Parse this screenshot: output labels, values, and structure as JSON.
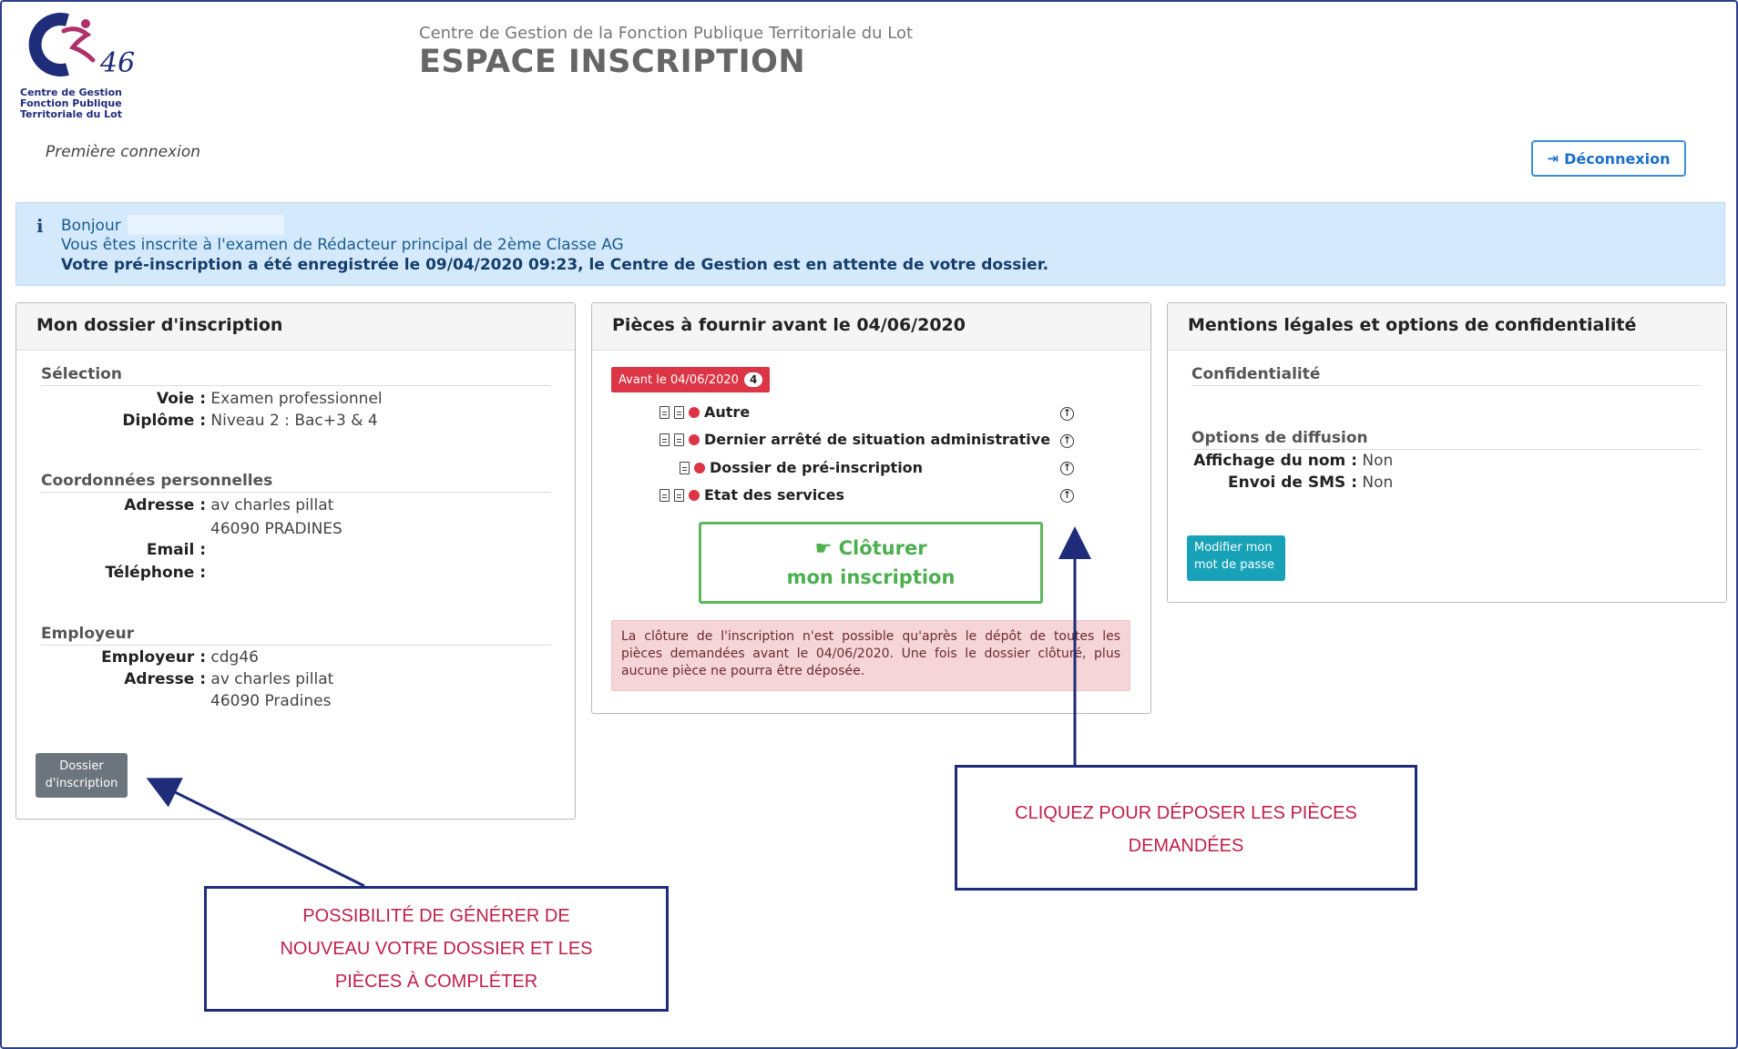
{
  "header": {
    "logo_number": "46",
    "logo_lines": [
      "Centre de Gestion",
      "Fonction Publique",
      "Territoriale du Lot"
    ],
    "organization": "Centre de Gestion de la Fonction Publique Territoriale du Lot",
    "title": "ESPACE INSCRIPTION",
    "subtitle": "Première connexion",
    "logout_label": "Déconnexion"
  },
  "banner": {
    "greeting": "Bonjour",
    "line2": "Vous êtes inscrite à l'examen de Rédacteur principal de 2ème Classe AG",
    "line3": "Votre pré-inscription a été enregistrée le 09/04/2020 09:23, le Centre de Gestion est en attente de votre dossier."
  },
  "dossier": {
    "title": "Mon dossier d'inscription",
    "selection_title": "Sélection",
    "voie_label": "Voie :",
    "voie_value": "Examen professionnel",
    "diplome_label": "Diplôme :",
    "diplome_value": "Niveau 2 : Bac+3 & 4",
    "coord_title": "Coordonnées personnelles",
    "adresse_label": "Adresse :",
    "adresse_line1": "av charles pillat",
    "adresse_line2": "46090 PRADINES",
    "email_label": "Email :",
    "tel_label": "Téléphone :",
    "employeur_title": "Employeur",
    "employeur_label": "Employeur :",
    "employeur_value": "cdg46",
    "emp_adresse_label": "Adresse :",
    "emp_adresse_line1": "av charles pillat",
    "emp_adresse_line2": "46090 Pradines",
    "button_line1": "Dossier",
    "button_line2": "d'inscription"
  },
  "pieces": {
    "title": "Pièces à fournir avant le 04/06/2020",
    "badge_label": "Avant le 04/06/2020",
    "badge_count": "4",
    "items": [
      "Autre",
      "Dernier arrêté de situation administrative",
      "Dossier de pré-inscription",
      "Etat des services"
    ],
    "close_line1": "Clôturer",
    "close_line2": "mon inscription",
    "alert": "La clôture de l'inscription n'est possible qu'après le dépôt de toutes les pièces demandées avant le 04/06/2020. Une fois le dossier clôturé, plus aucune pièce ne pourra être déposée."
  },
  "mentions": {
    "title": "Mentions légales et options de confidentialité",
    "conf_title": "Confidentialité",
    "options_title": "Options de diffusion",
    "nom_label": "Affichage du nom :",
    "nom_value": "Non",
    "sms_label": "Envoi de SMS :",
    "sms_value": "Non",
    "button_line1": "Modifier mon",
    "button_line2": "mot de passe"
  },
  "callouts": {
    "upload_line1": "CLIQUEZ POUR DÉPOSER LES PIÈCES",
    "upload_line2": "DEMANDÉES",
    "regen_line1": "POSSIBILITÉ DE GÉNÉRER DE",
    "regen_line2": "NOUVEAU VOTRE DOSSIER ET LES",
    "regen_line3": "PIÈCES À COMPLÉTER"
  },
  "colors": {
    "accent": "#1a6fc9",
    "danger": "#dc3545",
    "success": "#5cb85c",
    "callout_text": "#c0204a",
    "callout_border": "#1e2c7a"
  }
}
